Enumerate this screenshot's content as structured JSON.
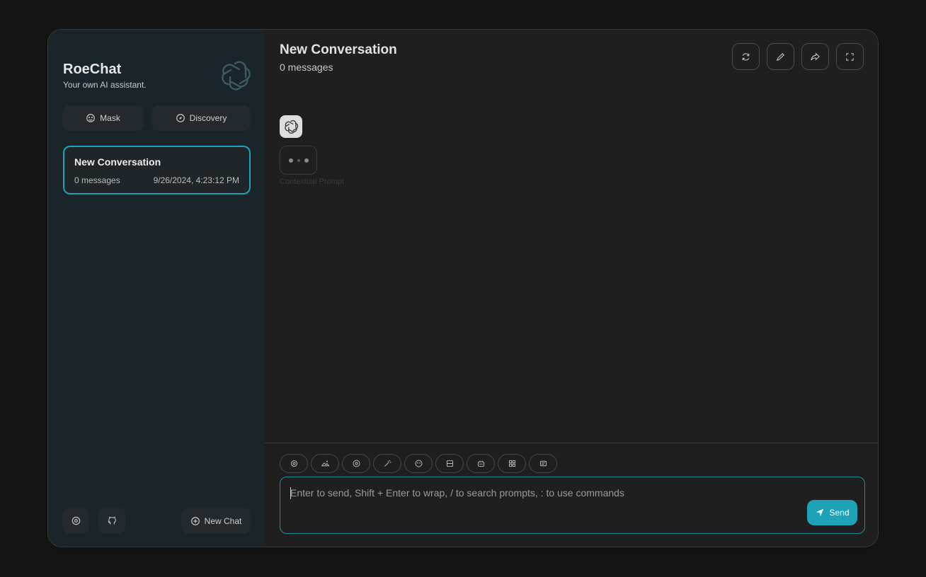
{
  "sidebar": {
    "title": "RoeChat",
    "subtitle": "Your own AI assistant.",
    "logo_icon": "openai-logo-icon",
    "mask_label": "Mask",
    "discovery_label": "Discovery",
    "conversations": [
      {
        "title": "New Conversation",
        "count": "0 messages",
        "date": "9/26/2024, 4:23:12 PM"
      }
    ],
    "settings_icon": "gear-icon",
    "github_icon": "github-icon",
    "new_chat_label": "New Chat"
  },
  "chat": {
    "title": "New Conversation",
    "subtitle": "0 messages",
    "actions": [
      "refresh-icon",
      "edit-icon",
      "share-icon",
      "fullscreen-icon"
    ],
    "context_label": "Contextual Prompt"
  },
  "input": {
    "placeholder": "Enter to send, Shift + Enter to wrap, / to search prompts, : to use commands",
    "send_label": "Send",
    "tools": [
      "settings-icon",
      "image-icon",
      "theme-icon",
      "magic-wand-icon",
      "mask-icon",
      "layout-icon",
      "robot-icon",
      "plugins-icon",
      "template-icon"
    ]
  },
  "colors": {
    "accent": "#1da2b8",
    "sidebar_bg": "#1a2529",
    "main_bg": "#1f1f1f",
    "page_bg": "#161616"
  }
}
